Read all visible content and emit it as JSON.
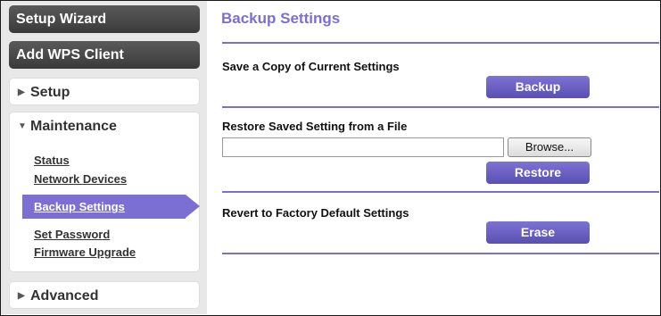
{
  "sidebar": {
    "setup_wizard": "Setup Wizard",
    "add_wps_client": "Add WPS Client",
    "setup": "Setup",
    "maintenance": "Maintenance",
    "maintenance_items": [
      "Status",
      "Network Devices",
      "Backup Settings",
      "Set Password",
      "Firmware Upgrade"
    ],
    "active_item": "Backup Settings",
    "advanced": "Advanced"
  },
  "main": {
    "title": "Backup Settings",
    "save_copy_label": "Save a Copy of Current Settings",
    "backup_button": "Backup",
    "restore_label": "Restore Saved Setting from a File",
    "file_value": "",
    "browse_button": "Browse...",
    "restore_button": "Restore",
    "revert_label": "Revert to Factory Default Settings",
    "erase_button": "Erase"
  },
  "colors": {
    "accent": "#7b6fd3",
    "sidebar_bg": "#e8e8e8",
    "dark_button": "#444444"
  },
  "icons": {
    "collapsed": "triangle-right-icon",
    "expanded": "triangle-down-icon"
  }
}
